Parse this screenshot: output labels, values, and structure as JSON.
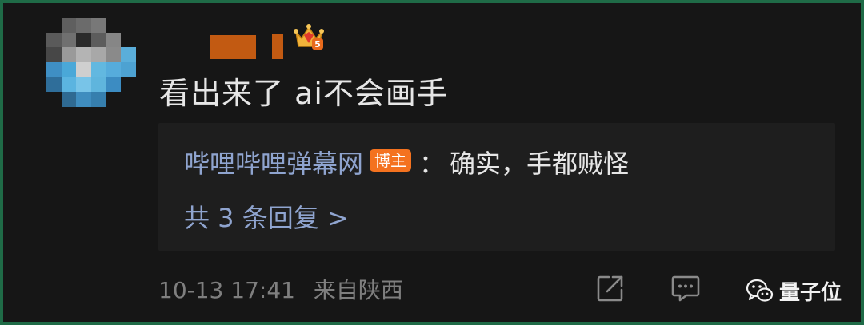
{
  "comment": {
    "text": "看出来了 ai不会画手"
  },
  "reply": {
    "author": "哔哩哔哩弹幕网",
    "badge": "博主",
    "colon": "：",
    "content": "确实，手都贼怪",
    "count_label": "共 3 条回复 >"
  },
  "meta": {
    "timestamp": "10-13 17:41",
    "location": "来自陕西"
  },
  "actions": {
    "share_icon": "share-icon",
    "comment_icon": "comment-icon"
  },
  "watermark": {
    "text": "量子位",
    "icon": "wechat-icon"
  },
  "colors": {
    "background": "#161616",
    "border": "#1f6b47",
    "link": "#8fa4cf",
    "badge": "#f4721f",
    "username_redacted": "#c25a12"
  }
}
